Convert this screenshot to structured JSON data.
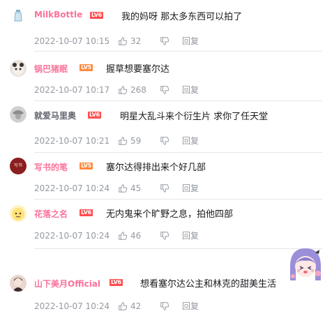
{
  "comments": [
    {
      "user": "MilkBottle",
      "name_color": "#fb7299",
      "level": "LV6",
      "text": "我的妈呀 那太多东西可以拍了",
      "time": "2022-10-07 10:15",
      "likes": "32",
      "reply": "回复"
    },
    {
      "user": "锅巴猪眠",
      "name_color": "#fb7299",
      "level": "LV5",
      "text": "握草想要塞尔达",
      "time": "2022-10-07 10:17",
      "likes": "268",
      "reply": "回复"
    },
    {
      "user": "就爱马里奥",
      "name_color": "#61666d",
      "level": "LV6",
      "text": "明星大乱斗来个衍生片 求你了任天堂",
      "time": "2022-10-07 10:21",
      "likes": "59",
      "reply": "回复"
    },
    {
      "user": "写书的笔",
      "name_color": "#fb7299",
      "level": "LV5",
      "text": "塞尔达得排出来个好几部",
      "time": "2022-10-07 10:24",
      "likes": "45",
      "reply": "回复"
    },
    {
      "user": "花落之名",
      "name_color": "#fb7299",
      "level": "LV6",
      "text": "无内鬼来个旷野之息，拍他四部",
      "time": "2022-10-07 10:24",
      "likes": "46",
      "reply": "回复"
    },
    {
      "user": "山下美月Official",
      "name_color": "#fb7299",
      "level": "LV6",
      "text": "想看塞尔达公主和林克的甜美生活",
      "time": "2022-10-07 10:24",
      "likes": "42",
      "reply": "回复"
    }
  ],
  "avatar_texts": {
    "c4": "写书"
  }
}
